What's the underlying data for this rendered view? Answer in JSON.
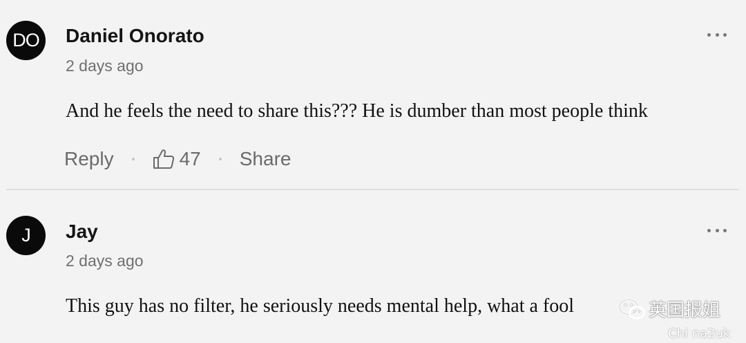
{
  "comments": [
    {
      "initials": "DO",
      "author": "Daniel Onorato",
      "time": "2 days ago",
      "text": "And he feels the need to share this??? He is dumber than most people think",
      "reply_label": "Reply",
      "likes": "47",
      "share_label": "Share"
    },
    {
      "initials": "J",
      "author": "Jay",
      "time": "2 days ago",
      "text": "This guy has no filter, he seriously needs mental help, what a fool"
    }
  ],
  "watermark": {
    "title": "英国报姐",
    "sub": "Chi na2uk"
  },
  "colors": {
    "background": "#f3f3f3",
    "avatar": "#0a0a0a",
    "muted_text": "#6a6a6a",
    "divider": "#dedede"
  },
  "icons": {
    "more": "more-horizontal-icon",
    "like": "thumbs-up-icon",
    "watermark": "wechat-icon"
  }
}
